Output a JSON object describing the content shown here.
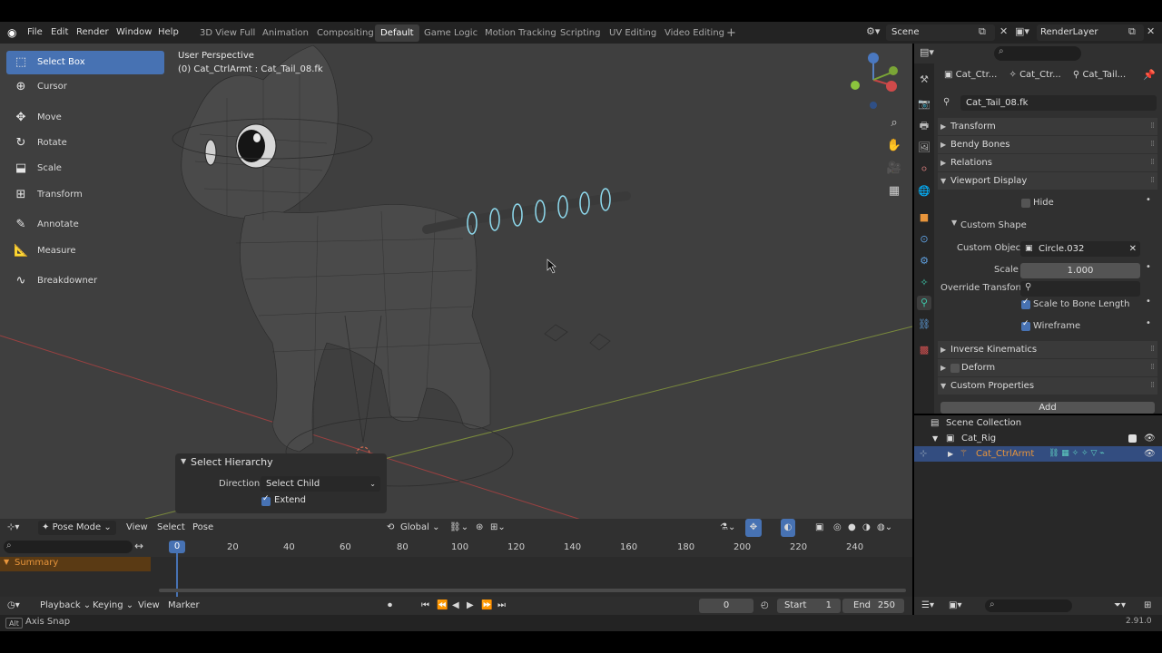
{
  "colors": {
    "accent": "#4772b3",
    "header_bg": "#232323",
    "viewport_bg": "#3f3f3f",
    "panel_bg": "#303030",
    "orange_text": "#e8953b",
    "selection_blue": "#334d80"
  },
  "menu": {
    "file": "File",
    "edit": "Edit",
    "render": "Render",
    "window": "Window",
    "help": "Help"
  },
  "workspaces": [
    "3D View Full",
    "Animation",
    "Compositing",
    "Default",
    "Game Logic",
    "Motion Tracking",
    "Scripting",
    "UV Editing",
    "Video Editing"
  ],
  "workspace_add": "+",
  "scene": {
    "name": "Scene",
    "render_layer": "RenderLayer"
  },
  "viewport": {
    "view_name": "User Perspective",
    "object_info": "(0) Cat_CtrlArmt : Cat_Tail_08.fk",
    "tools": [
      {
        "label": "Select Box",
        "icon": "⬚"
      },
      {
        "label": "Cursor",
        "icon": "⊕"
      },
      {
        "label": "Move",
        "icon": "✥"
      },
      {
        "label": "Rotate",
        "icon": "↻"
      },
      {
        "label": "Scale",
        "icon": "⬓"
      },
      {
        "label": "Transform",
        "icon": "⊞"
      },
      {
        "label": "Annotate",
        "icon": "✎"
      },
      {
        "label": "Measure",
        "icon": "📐"
      },
      {
        "label": "Breakdowner",
        "icon": "∿"
      }
    ],
    "gizmo": {
      "x": "X",
      "y": "Y",
      "z": "Z"
    }
  },
  "redo_panel": {
    "title": "Select Hierarchy",
    "direction_label": "Direction",
    "direction_value": "Select Child",
    "extend_label": "Extend",
    "extend_checked": true
  },
  "viewport_header": {
    "mode": "Pose Mode",
    "view": "View",
    "select": "Select",
    "pose": "Pose",
    "orientation": "Global"
  },
  "timeline": {
    "current_frame_marker": "0",
    "ticks": [
      "20",
      "40",
      "60",
      "80",
      "100",
      "120",
      "140",
      "160",
      "180",
      "200",
      "220",
      "240"
    ],
    "summary": "Summary",
    "footer": {
      "playback": "Playback",
      "keying": "Keying",
      "view": "View",
      "marker": "Marker",
      "current_frame": "0",
      "start_label": "Start",
      "start": "1",
      "end_label": "End",
      "end": "250"
    }
  },
  "statusbar": {
    "key": "Alt",
    "hint": "Axis Snap",
    "version": "2.91.0"
  },
  "properties": {
    "breadcrumbs": [
      "Cat_Ctr...",
      "Cat_Ctr...",
      "Cat_Tail..."
    ],
    "bone_name": "Cat_Tail_08.fk",
    "panels": {
      "transform": "Transform",
      "bendy_bones": "Bendy Bones",
      "relations": "Relations",
      "viewport_display": "Viewport Display",
      "hide": "Hide",
      "custom_shape": "Custom Shape",
      "custom_object_label": "Custom Object",
      "custom_object_value": "Circle.032",
      "scale_label": "Scale",
      "scale_value": "1.000",
      "override_transform_label": "Override Transform",
      "scale_to_bone_length": "Scale to Bone Length",
      "wireframe": "Wireframe",
      "inverse_kinematics": "Inverse Kinematics",
      "deform": "Deform",
      "custom_properties": "Custom Properties",
      "add": "Add"
    }
  },
  "outliner": {
    "scene_collection": "Scene Collection",
    "collection": "Cat_Rig",
    "armature": "Cat_CtrlArmt"
  }
}
